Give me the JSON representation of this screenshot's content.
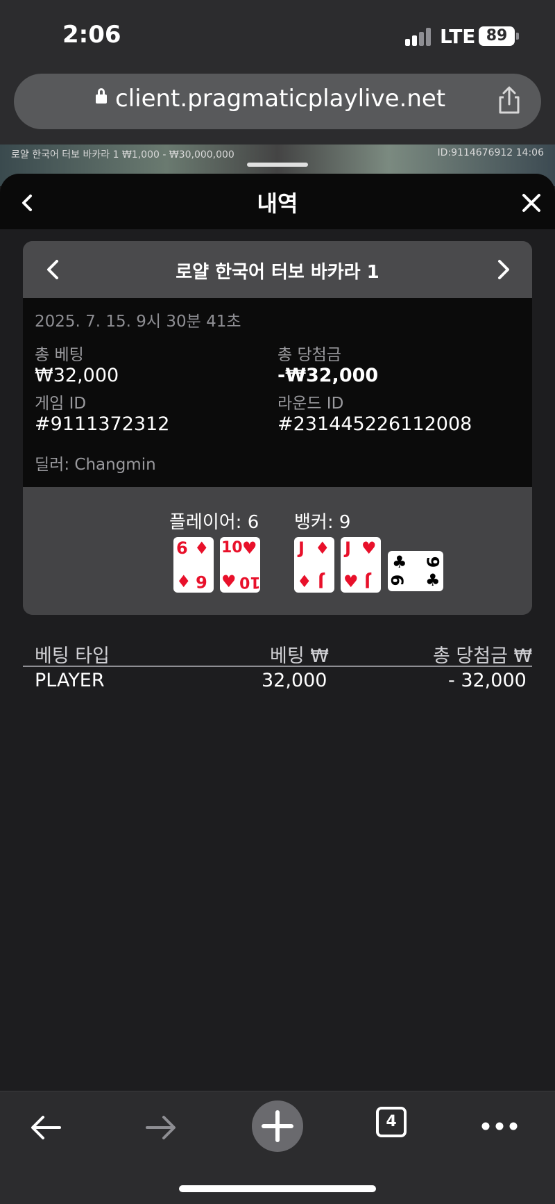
{
  "status_bar": {
    "time": "2:06",
    "network": "LTE",
    "battery": "89"
  },
  "browser": {
    "url": "client.pragmaticplaylive.net",
    "tab_count": "4"
  },
  "game_strip": {
    "left_text": "로얄 한국어 터보 바카라 1  ₩1,000 - ₩30,000,000",
    "right_text": "ID:9114676912  14:06"
  },
  "modal": {
    "title": "내역"
  },
  "round": {
    "game_name": "로얄 한국어 터보 바카라 1",
    "datetime": "2025. 7. 15. 9시 30분 41초",
    "total_bet_label": "총 베팅",
    "total_bet_value": "₩32,000",
    "total_win_label": "총 당첨금",
    "total_win_value": "-₩32,000",
    "game_id_label": "게임 ID",
    "game_id_value": "#9111372312",
    "round_id_label": "라운드 ID",
    "round_id_value": "#231445226112008",
    "dealer": "딜러: Changmin"
  },
  "hands": {
    "player_label": "플레이어: 6",
    "banker_label": "뱅커: 9",
    "player_cards": [
      {
        "rank": "6",
        "suit": "♦",
        "color": "#e8102a"
      },
      {
        "rank": "10",
        "suit": "♥",
        "color": "#e8102a"
      }
    ],
    "banker_cards": [
      {
        "rank": "J",
        "suit": "♦",
        "color": "#e8102a"
      },
      {
        "rank": "J",
        "suit": "♥",
        "color": "#e8102a"
      },
      {
        "rank": "9",
        "suit": "♣",
        "color": "#000000"
      }
    ]
  },
  "bets_table": {
    "headers": [
      "베팅 타입",
      "베팅 ₩",
      "총 당첨금 ₩"
    ],
    "rows": [
      {
        "type": "PLAYER",
        "bet": "32,000",
        "win": "- 32,000"
      }
    ]
  }
}
